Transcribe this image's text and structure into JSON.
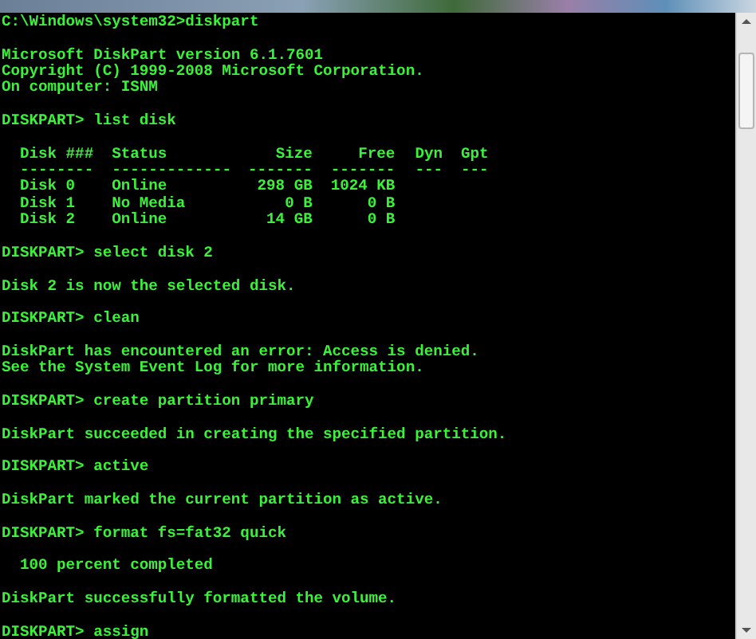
{
  "lines": [
    {
      "kind": "command",
      "text": "C:\\Windows\\system32>diskpart"
    },
    {
      "kind": "blank"
    },
    {
      "kind": "output",
      "text": "Microsoft DiskPart version 6.1.7601"
    },
    {
      "kind": "output",
      "text": "Copyright (C) 1999-2008 Microsoft Corporation."
    },
    {
      "kind": "output",
      "text": "On computer: ISNM"
    },
    {
      "kind": "blank"
    },
    {
      "kind": "command",
      "text": "DISKPART> list disk"
    },
    {
      "kind": "blank"
    },
    {
      "kind": "table",
      "columns": [
        "Disk ###",
        "Status",
        "Size",
        "Free",
        "Dyn",
        "Gpt"
      ],
      "rules": [
        "--------",
        "-------------",
        "-------",
        "-------",
        "---",
        "---"
      ],
      "rows": [
        [
          "Disk 0",
          "Online",
          "298 GB",
          "1024 KB"
        ],
        [
          "Disk 1",
          "No Media",
          "0 B",
          "0 B"
        ],
        [
          "Disk 2",
          "Online",
          "14 GB",
          "0 B"
        ]
      ]
    },
    {
      "kind": "blank"
    },
    {
      "kind": "command",
      "text": "DISKPART> select disk 2"
    },
    {
      "kind": "blank"
    },
    {
      "kind": "output",
      "text": "Disk 2 is now the selected disk."
    },
    {
      "kind": "blank"
    },
    {
      "kind": "command",
      "text": "DISKPART> clean"
    },
    {
      "kind": "blank"
    },
    {
      "kind": "output",
      "text": "DiskPart has encountered an error: Access is denied."
    },
    {
      "kind": "output",
      "text": "See the System Event Log for more information."
    },
    {
      "kind": "blank"
    },
    {
      "kind": "command",
      "text": "DISKPART> create partition primary"
    },
    {
      "kind": "blank"
    },
    {
      "kind": "output",
      "text": "DiskPart succeeded in creating the specified partition."
    },
    {
      "kind": "blank"
    },
    {
      "kind": "command",
      "text": "DISKPART> active"
    },
    {
      "kind": "blank"
    },
    {
      "kind": "output",
      "text": "DiskPart marked the current partition as active."
    },
    {
      "kind": "blank"
    },
    {
      "kind": "command",
      "text": "DISKPART> format fs=fat32 quick"
    },
    {
      "kind": "blank"
    },
    {
      "kind": "output",
      "text": "  100 percent completed"
    },
    {
      "kind": "blank"
    },
    {
      "kind": "output",
      "text": "DiskPart successfully formatted the volume."
    },
    {
      "kind": "blank"
    },
    {
      "kind": "command",
      "text": "DISKPART> assign"
    }
  ]
}
